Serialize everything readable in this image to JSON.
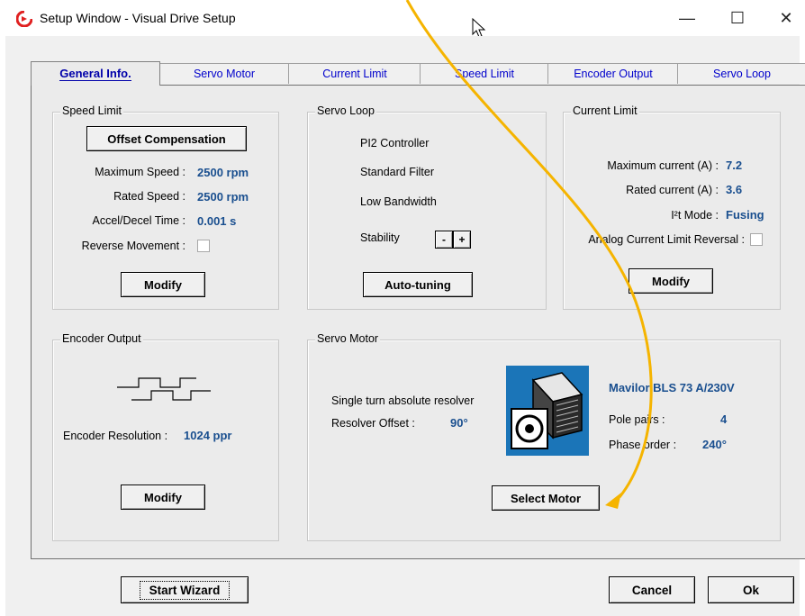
{
  "window": {
    "title": "Setup Window - Visual Drive Setup",
    "minimize_glyph": "—",
    "maximize_glyph": "☐",
    "close_glyph": "✕"
  },
  "tabs": [
    {
      "label": "General Info."
    },
    {
      "label": "Servo Motor"
    },
    {
      "label": "Current Limit"
    },
    {
      "label": "Speed Limit"
    },
    {
      "label": "Encoder Output"
    },
    {
      "label": "Servo Loop"
    }
  ],
  "speed_limit": {
    "title": "Speed Limit",
    "offset_button": "Offset Compensation",
    "max_speed_label": "Maximum Speed :",
    "max_speed_value": "2500 rpm",
    "rated_speed_label": "Rated Speed :",
    "rated_speed_value": "2500 rpm",
    "accel_label": "Accel/Decel Time :",
    "accel_value": "0.001 s",
    "reverse_label": "Reverse Movement :",
    "reverse_checked": false,
    "modify_button": "Modify"
  },
  "servo_loop": {
    "title": "Servo Loop",
    "controller": "PI2 Controller",
    "filter": "Standard Filter",
    "bandwidth": "Low Bandwidth",
    "stability_label": "Stability",
    "minus_button": "-",
    "plus_button": "+",
    "autotune_button": "Auto-tuning"
  },
  "current_limit": {
    "title": "Current Limit",
    "max_current_label": "Maximum current (A) :",
    "max_current_value": "7.2",
    "rated_current_label": "Rated current (A) :",
    "rated_current_value": "3.6",
    "i2t_label": "I²t Mode :",
    "i2t_value": "Fusing",
    "reversal_label": "Analog Current Limit Reversal :",
    "reversal_checked": false,
    "modify_button": "Modify"
  },
  "encoder_output": {
    "title": "Encoder Output",
    "resolution_label": "Encoder Resolution :",
    "resolution_value": "1024 ppr",
    "modify_button": "Modify"
  },
  "servo_motor": {
    "title": "Servo Motor",
    "resolver_type": "Single turn absolute resolver",
    "resolver_offset_label": "Resolver Offset :",
    "resolver_offset_value": "90°",
    "motor_name": "Mavilor BLS 73 A/230V",
    "pole_pairs_label": "Pole pairs :",
    "pole_pairs_value": "4",
    "phase_order_label": "Phase order :",
    "phase_order_value": "240°",
    "select_button": "Select Motor"
  },
  "footer": {
    "start_wizard": "Start Wizard",
    "cancel": "Cancel",
    "ok": "Ok"
  },
  "colors": {
    "value_text": "#1a4f8f",
    "tab_text": "#0000cc",
    "annotation_arrow": "#f5b400",
    "motor_bg": "#1b75b8"
  },
  "icons": [
    "app-icon",
    "minimize-icon",
    "maximize-icon",
    "close-icon",
    "square-wave-icon",
    "motor-image",
    "mouse-cursor-icon",
    "annotation-arrow"
  ]
}
